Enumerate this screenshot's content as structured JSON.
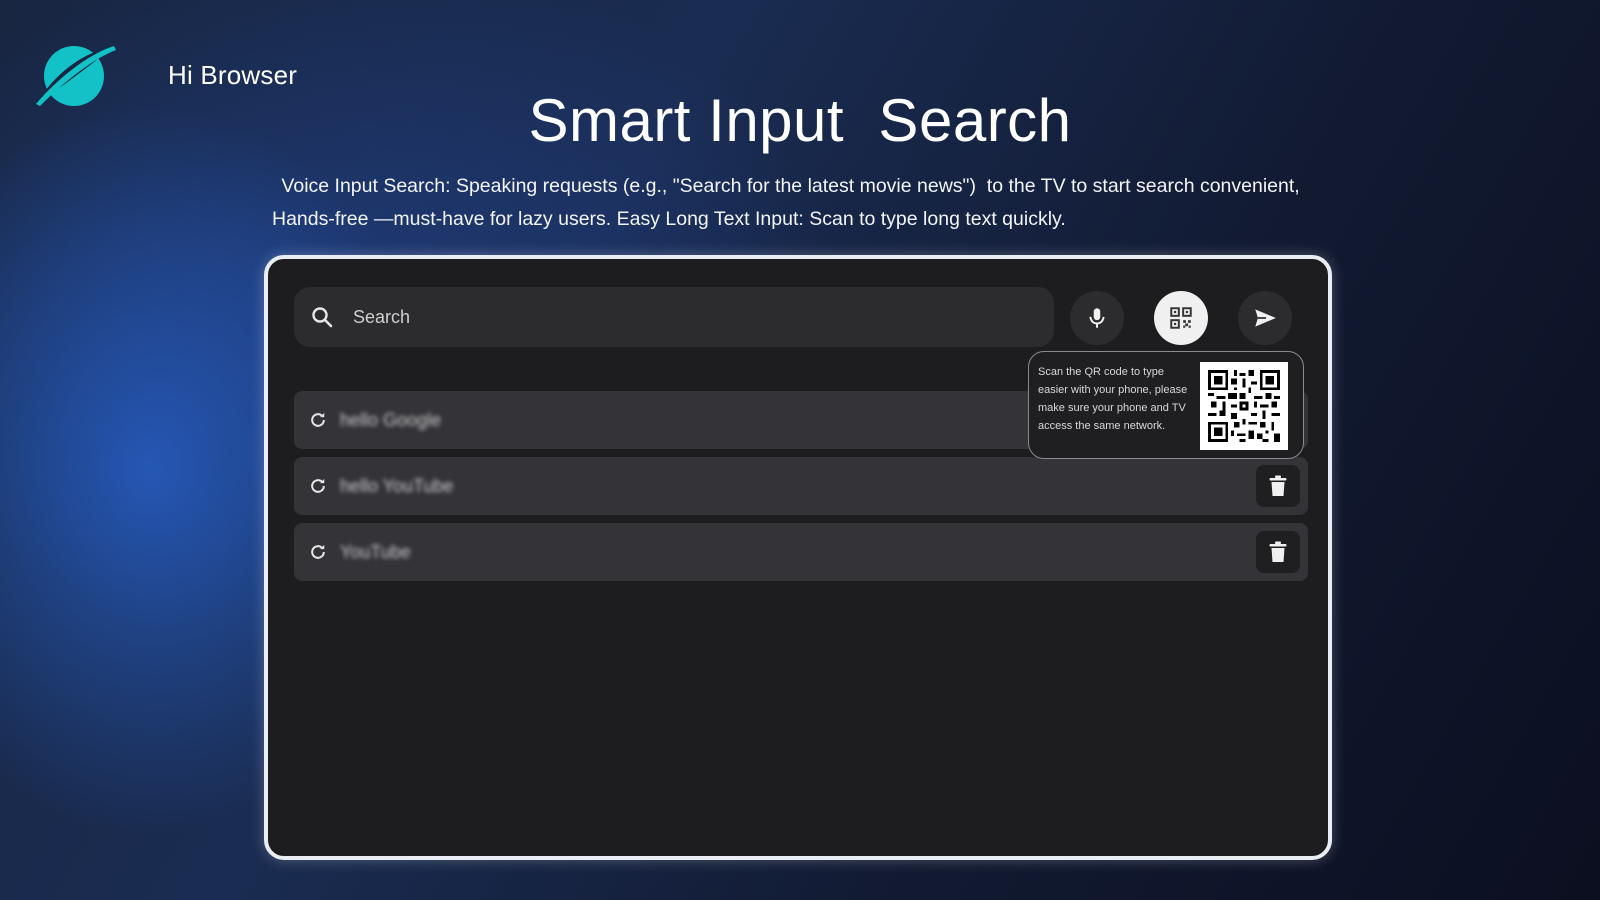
{
  "brand": {
    "name": "Hi Browser",
    "logo_icon": "planet-logo-icon",
    "accent": "#12c2c7"
  },
  "headline": "Smart Input  Search",
  "description": {
    "line1": " Voice Input Search: Speaking requests (e.g., \"Search for the latest movie news\")  to the TV to start search convenient,",
    "line2": "Hands-free —must-have for lazy users. Easy Long Text Input: Scan to type long text quickly."
  },
  "search": {
    "placeholder": "Search",
    "value": "",
    "icon": "search-icon"
  },
  "actions": [
    {
      "name": "voice",
      "icon": "microphone-icon"
    },
    {
      "name": "scan",
      "icon": "qr-scan-icon",
      "active": true
    },
    {
      "name": "send",
      "icon": "send-icon"
    }
  ],
  "qr_popup": {
    "text": "Scan the QR code to type easier with your phone, please make sure your phone and TV access the same network.",
    "icon": "qr-code-icon"
  },
  "history": [
    {
      "text": "hello Google",
      "icon": "history-refresh-icon",
      "delete_icon": "trash-icon"
    },
    {
      "text": "hello YouTube",
      "icon": "history-refresh-icon",
      "delete_icon": "trash-icon"
    },
    {
      "text": "YouTube",
      "icon": "history-refresh-icon",
      "delete_icon": "trash-icon"
    }
  ],
  "colors": {
    "panel": "#1d1d1f",
    "row": "#343438",
    "border": "#e9eef5"
  }
}
